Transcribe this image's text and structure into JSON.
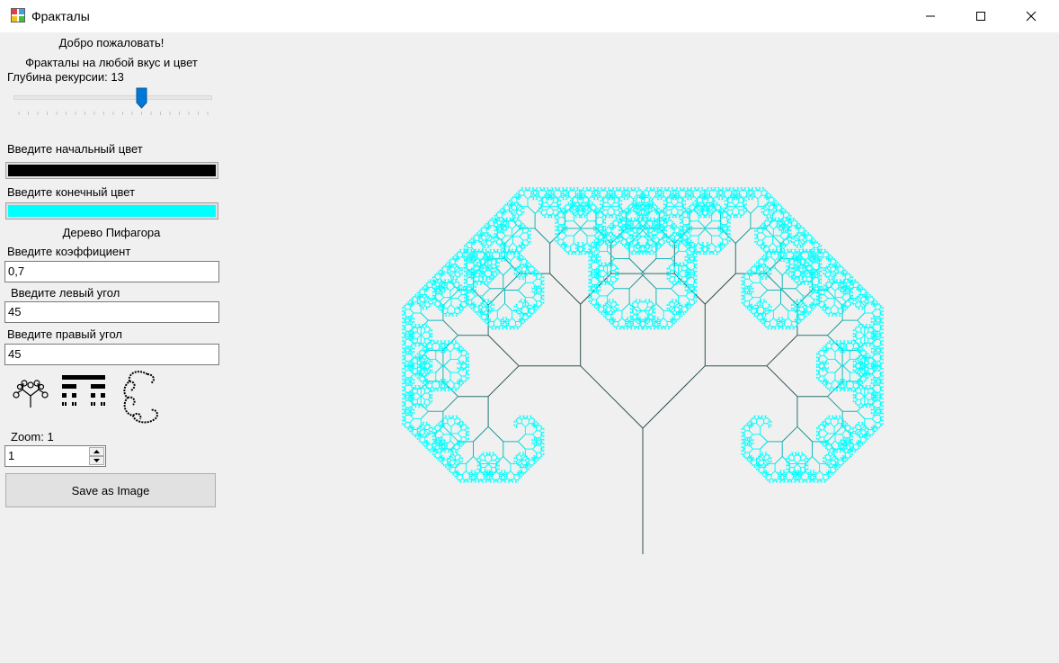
{
  "window": {
    "title": "Фракталы",
    "icon": "app-icon"
  },
  "panel": {
    "welcome": "Добро пожаловать!",
    "subtitle": "Фракталы на любой вкус и цвет",
    "depth_label": "Глубина рекурсии: 13",
    "depth_slider": {
      "min": 0,
      "max": 20,
      "value": 13
    },
    "start_color_label": "Введите начальный цвет",
    "start_color": "#000000",
    "end_color_label": "Введите конечный цвет",
    "end_color": "#00ffff",
    "fractal_name": "Дерево Пифагора",
    "coef_label": "Введите коэффициент",
    "coef_value": "0,7",
    "left_angle_label": "Введите левый угол",
    "left_angle_value": "45",
    "right_angle_label": "Введите правый угол",
    "right_angle_value": "45",
    "fractal_types": [
      "tree-fractal-icon",
      "cantor-fractal-icon",
      "dragon-curve-fractal-icon"
    ],
    "zoom_label": "Zoom: 1",
    "zoom_value": "1",
    "save_label": "Save as Image"
  },
  "fractal": {
    "type": "pythagoras-tree",
    "depth": 13,
    "coefficient": 0.7,
    "left_angle": 45,
    "right_angle": 45,
    "trunk_color": "#2f4f4f",
    "leaf_color": "#00ffff"
  }
}
